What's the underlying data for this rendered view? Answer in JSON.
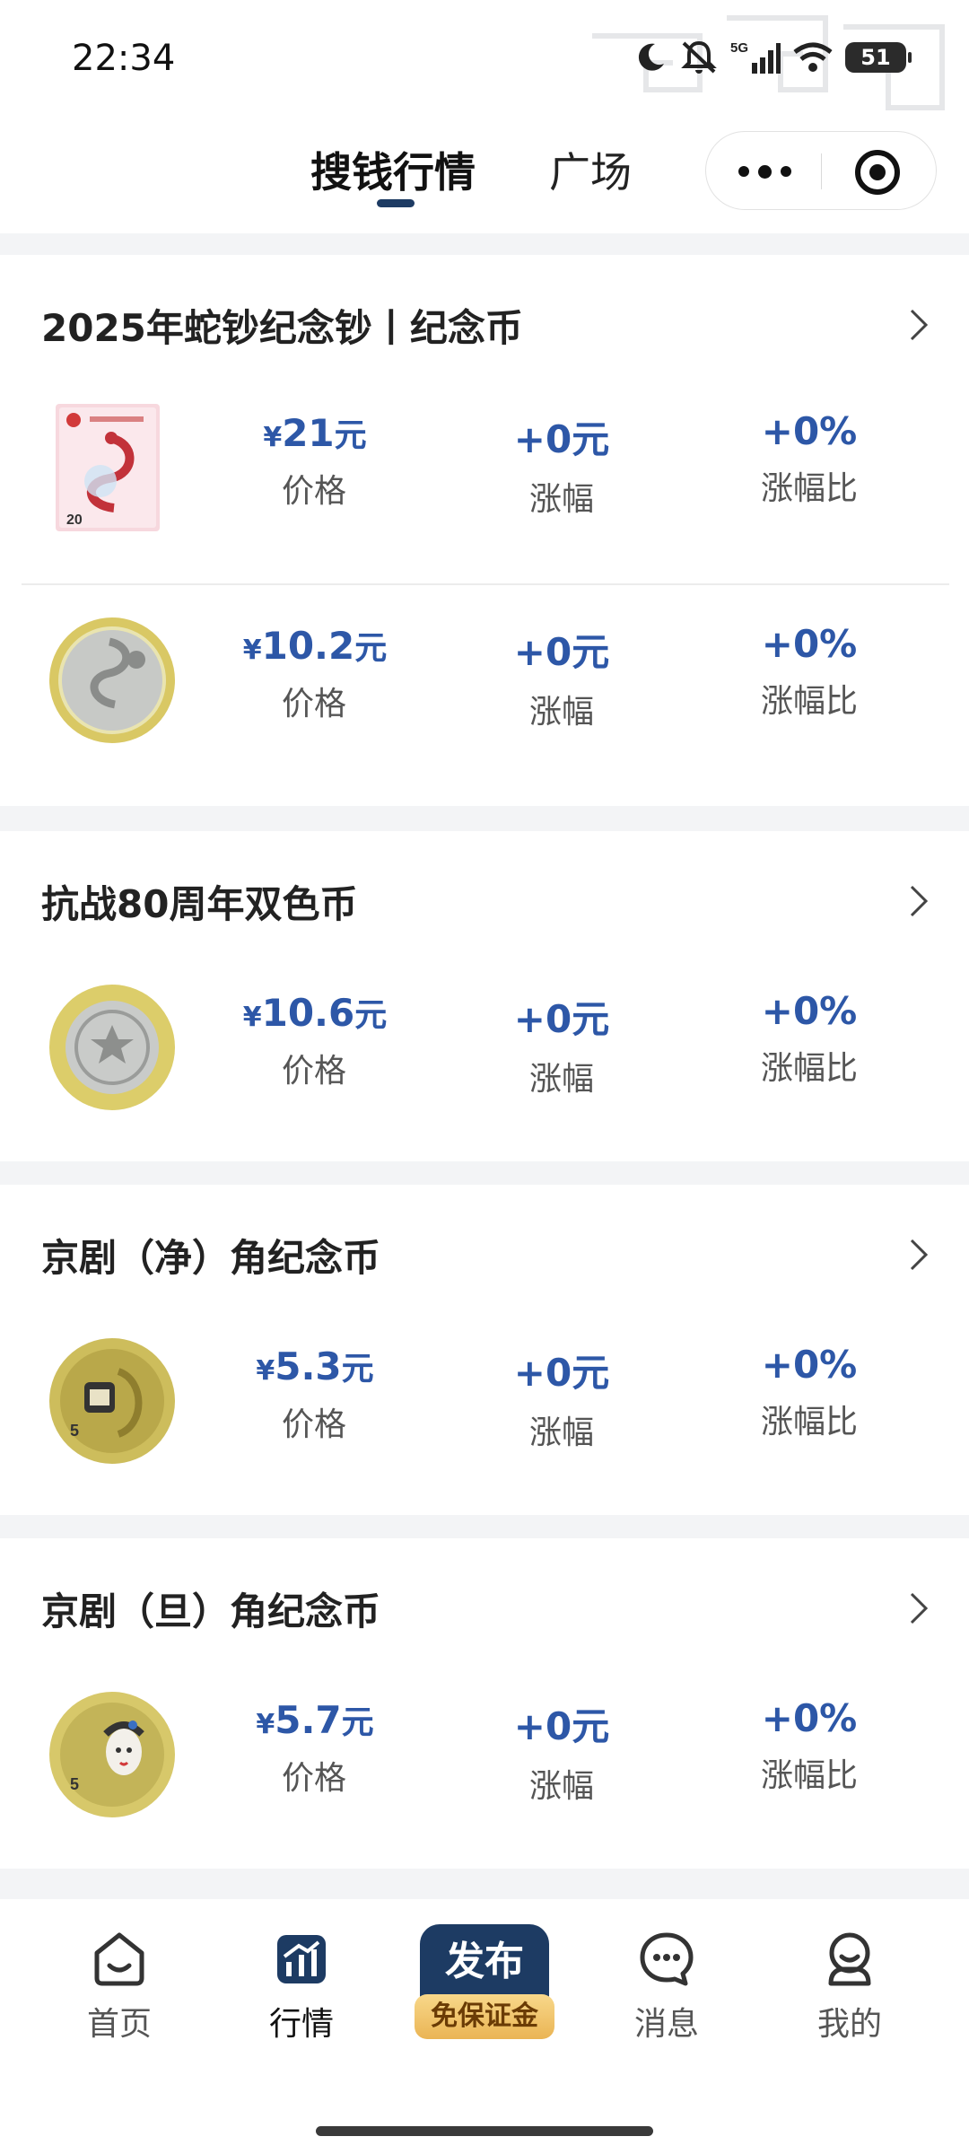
{
  "status_bar": {
    "time": "22:34",
    "network": "5G",
    "battery": "51"
  },
  "header": {
    "tabs": [
      {
        "label": "搜钱行情",
        "active": true
      },
      {
        "label": "广场",
        "active": false
      }
    ],
    "icons": [
      "more-icon",
      "target-icon"
    ]
  },
  "colors": {
    "accent": "#2d57a7",
    "brand_dark": "#1d3b63",
    "badge_gold": "#eab454"
  },
  "sections": [
    {
      "title": "2025年蛇钞纪念钞丨纪念币",
      "items": [
        {
          "thumb": "snake-banknote",
          "price": "21",
          "change": "+0元",
          "change_pct": "+0%",
          "price_label": "价格",
          "change_label": "涨幅",
          "pct_label": "涨幅比"
        },
        {
          "thumb": "snake-coin",
          "price": "10.2",
          "change": "+0元",
          "change_pct": "+0%",
          "price_label": "价格",
          "change_label": "涨幅",
          "pct_label": "涨幅比"
        }
      ]
    },
    {
      "title": "抗战80周年双色币",
      "items": [
        {
          "thumb": "anniversary-coin",
          "price": "10.6",
          "change": "+0元",
          "change_pct": "+0%",
          "price_label": "价格",
          "change_label": "涨幅",
          "pct_label": "涨幅比"
        }
      ]
    },
    {
      "title": "京剧（净）角纪念币",
      "items": [
        {
          "thumb": "opera-jing-coin",
          "price": "5.3",
          "change": "+0元",
          "change_pct": "+0%",
          "price_label": "价格",
          "change_label": "涨幅",
          "pct_label": "涨幅比"
        }
      ]
    },
    {
      "title": "京剧（旦）角纪念币",
      "items": [
        {
          "thumb": "opera-dan-coin",
          "price": "5.7",
          "change": "+0元",
          "change_pct": "+0%",
          "price_label": "价格",
          "change_label": "涨幅",
          "pct_label": "涨幅比"
        }
      ]
    }
  ],
  "price_prefix": "¥",
  "price_unit": "元",
  "bottom_nav": {
    "home": "首页",
    "market": "行情",
    "publish": "发布",
    "publish_badge": "免保证金",
    "messages": "消息",
    "mine": "我的"
  }
}
